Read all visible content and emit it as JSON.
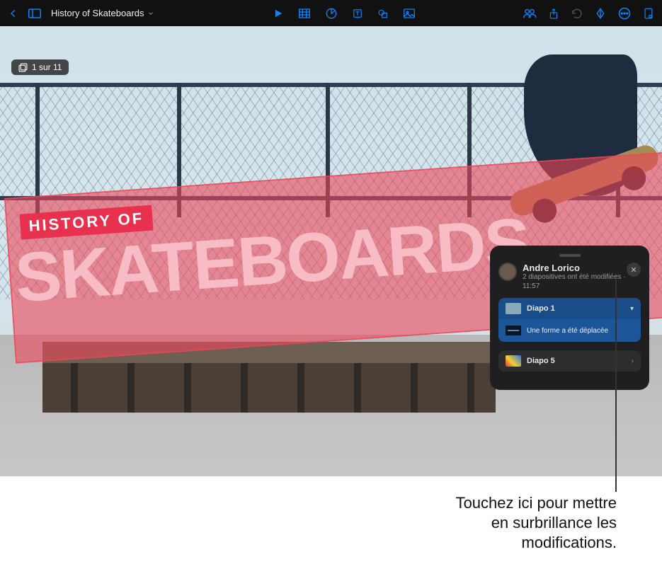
{
  "toolbar": {
    "title": "History of Skateboards"
  },
  "canvas": {
    "counter": "1 sur 11",
    "banner_line1": "HISTORY OF",
    "banner_line2": "SKATEBOARDS"
  },
  "activity": {
    "author": "Andre Lorico",
    "summary": "2 diapositives ont été modifiées ·",
    "time": "11:57",
    "items": [
      {
        "label": "Diapo 1",
        "change": "Une forme a été déplacée"
      },
      {
        "label": "Diapo 5"
      }
    ]
  },
  "callout": {
    "line1": "Touchez ici pour mettre",
    "line2": "en surbrillance les",
    "line3": "modifications."
  }
}
